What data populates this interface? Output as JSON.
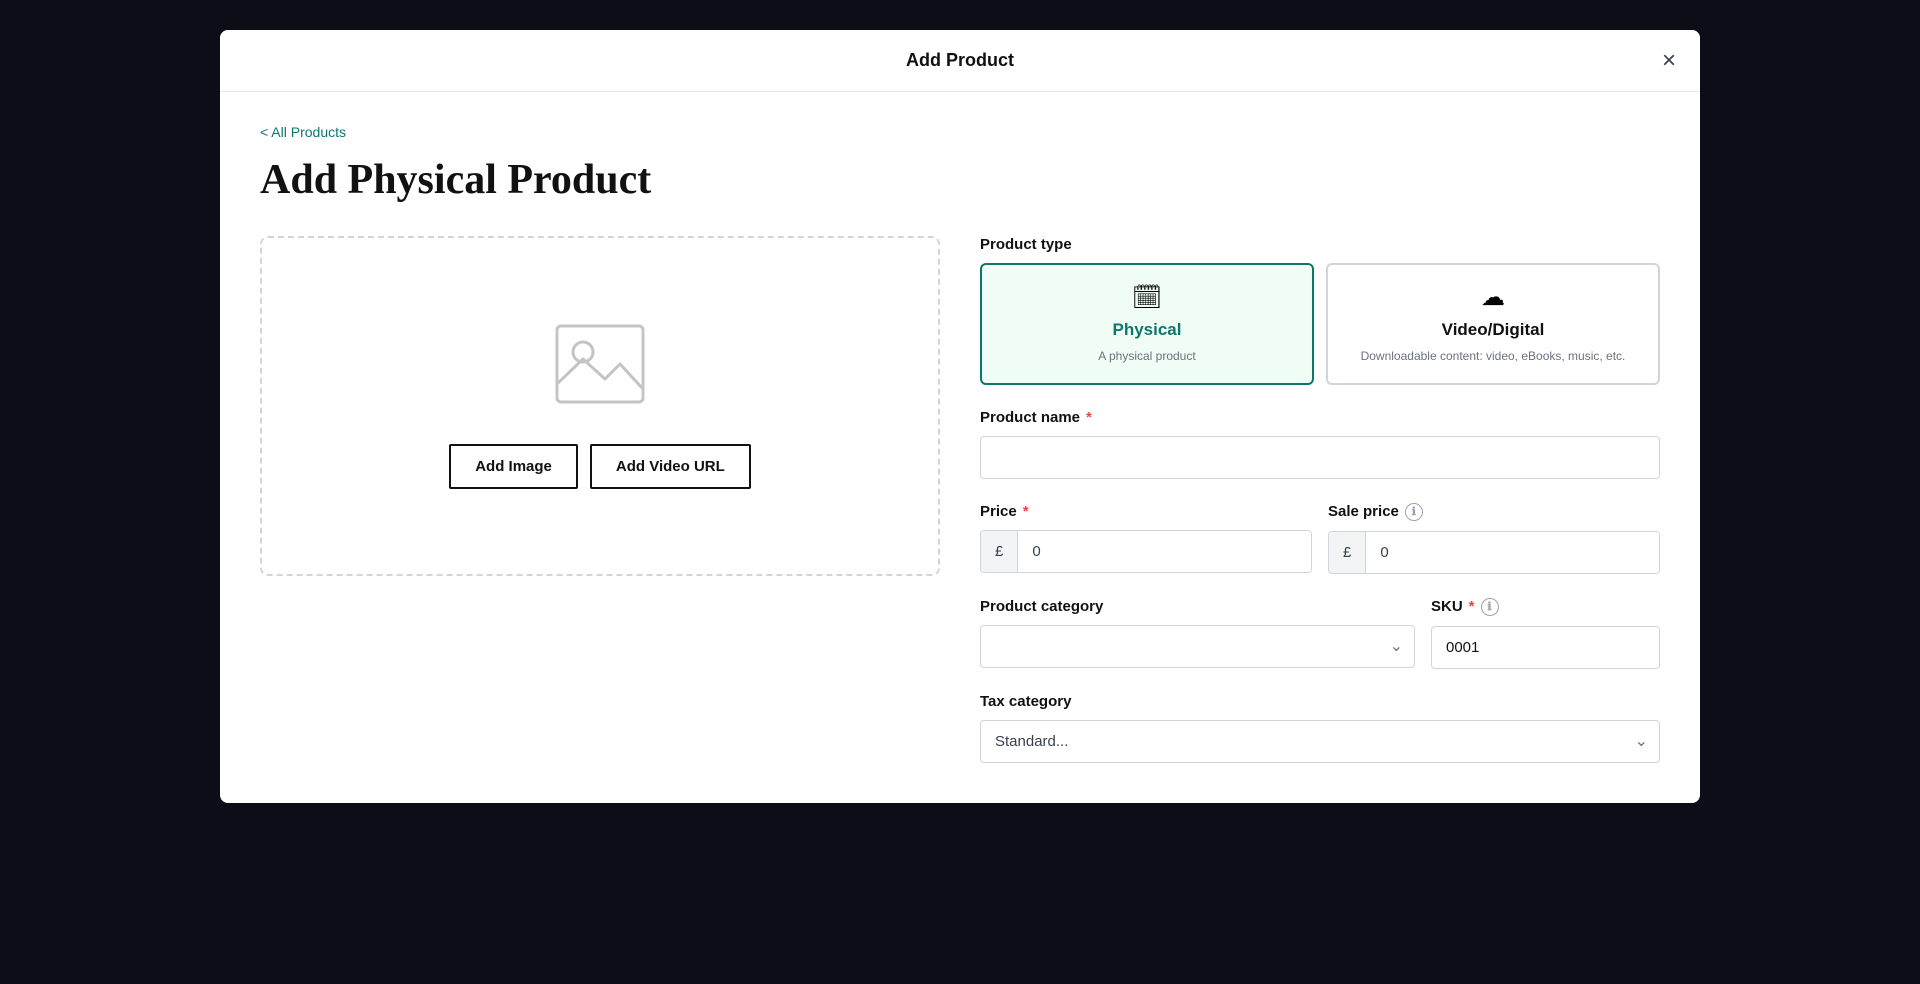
{
  "modal": {
    "title": "Add Product",
    "close_label": "×"
  },
  "breadcrumb": {
    "back_label": "< All Products"
  },
  "page_heading": "Add Physical Product",
  "image_section": {
    "add_image_label": "Add Image",
    "add_video_label": "Add Video URL"
  },
  "product_type": {
    "label": "Product type",
    "options": [
      {
        "id": "physical",
        "name": "Physical",
        "description": "A physical product",
        "selected": true
      },
      {
        "id": "digital",
        "name": "Video/Digital",
        "description": "Downloadable content: video, eBooks, music, etc.",
        "selected": false
      }
    ]
  },
  "product_name": {
    "label": "Product name",
    "required": true,
    "placeholder": ""
  },
  "price": {
    "label": "Price",
    "required": true,
    "currency": "£",
    "value": "0"
  },
  "sale_price": {
    "label": "Sale price",
    "currency": "£",
    "value": "0"
  },
  "product_category": {
    "label": "Product category",
    "placeholder": ""
  },
  "sku": {
    "label": "SKU",
    "required": true,
    "value": "0001"
  },
  "tax_category": {
    "label": "Tax category",
    "placeholder": "Standard..."
  }
}
